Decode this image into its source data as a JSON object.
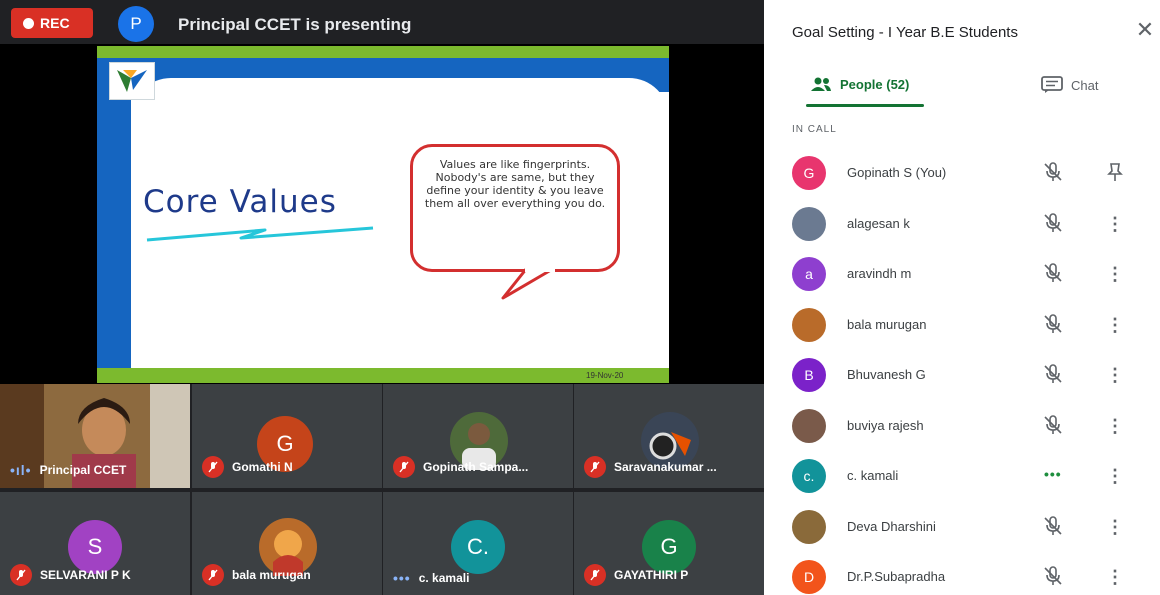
{
  "topbar": {
    "rec_label": "REC",
    "presenter_initial": "P",
    "presenter_title": "Principal CCET is presenting"
  },
  "slide": {
    "heading": "Core Values",
    "bubble_text": "Values are like fingerprints. Nobody's are same, but they define your identity & you leave them all over everything you do.",
    "date": "19-Nov-20"
  },
  "tiles": [
    {
      "name": "Principal CCET",
      "initial": "",
      "color": "",
      "status": "speaking"
    },
    {
      "name": "Gomathi N",
      "initial": "G",
      "color": "#c5441a",
      "status": "muted"
    },
    {
      "name": "Gopinath Sampa...",
      "initial": "",
      "color": "#6d5b3d",
      "status": "muted"
    },
    {
      "name": "Saravanakumar ...",
      "initial": "",
      "color": "#59606b",
      "status": "muted"
    },
    {
      "name": "SELVARANI P K",
      "initial": "S",
      "color": "#a142c3",
      "status": "muted"
    },
    {
      "name": "bala murugan",
      "initial": "",
      "color": "#b96b2a",
      "status": "muted"
    },
    {
      "name": "c. kamali",
      "initial": "C.",
      "color": "#12939a",
      "status": "active"
    },
    {
      "name": "GAYATHIRI P",
      "initial": "G",
      "color": "#19824a",
      "status": "muted"
    }
  ],
  "panel": {
    "title": "Goal Setting - I Year B.E Students",
    "close": "✕",
    "tab_people": "People (52)",
    "tab_chat": "Chat",
    "section": "IN CALL",
    "people": [
      {
        "name": "Gopinath S (You)",
        "initial": "G",
        "color": "#e8356e",
        "status": "muted",
        "action": "pin"
      },
      {
        "name": "alagesan k",
        "initial": "",
        "color": "#6b7a91",
        "status": "muted",
        "action": "more"
      },
      {
        "name": "aravindh m",
        "initial": "a",
        "color": "#8e3fcf",
        "status": "muted",
        "action": "more"
      },
      {
        "name": "bala murugan",
        "initial": "",
        "color": "#b96b2a",
        "status": "muted",
        "action": "more"
      },
      {
        "name": "Bhuvanesh G",
        "initial": "B",
        "color": "#7b22c9",
        "status": "muted",
        "action": "more"
      },
      {
        "name": "buviya rajesh",
        "initial": "",
        "color": "#7a5a4a",
        "status": "muted",
        "action": "more"
      },
      {
        "name": "c. kamali",
        "initial": "c.",
        "color": "#12939a",
        "status": "active",
        "action": "more"
      },
      {
        "name": "Deva Dharshini",
        "initial": "",
        "color": "#8a6a3a",
        "status": "muted",
        "action": "more"
      },
      {
        "name": "Dr.P.Subapradha",
        "initial": "D",
        "color": "#f2541b",
        "status": "muted",
        "action": "more"
      }
    ]
  }
}
